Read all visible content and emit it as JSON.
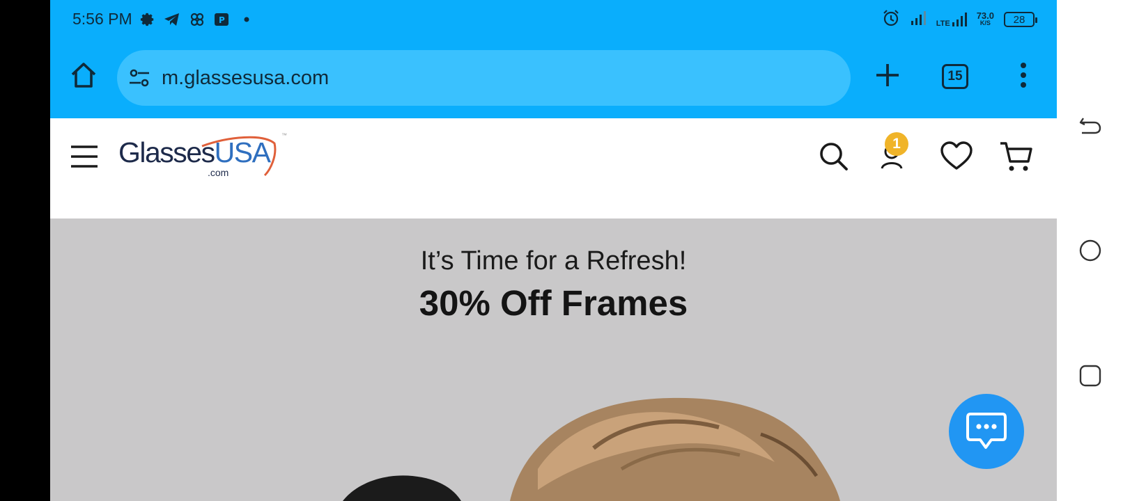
{
  "status_bar": {
    "time": "5:56 PM",
    "network_label": "LTE",
    "speed_value": "73.0",
    "speed_unit": "K/S",
    "battery": "28",
    "notification_icons": [
      "settings-icon",
      "telegram-icon",
      "pinwheel-icon",
      "app-icon",
      "dot-icon"
    ]
  },
  "browser": {
    "url": "m.glassesusa.com",
    "tab_count": "15",
    "icons": [
      "home-icon",
      "site-settings-icon",
      "plus-icon",
      "tabs-icon",
      "more-vert-icon"
    ]
  },
  "site_header": {
    "logo_main": "Glasses",
    "logo_accent": "USA",
    "logo_domain": ".com",
    "logo_tm": "™",
    "account_badge": "1",
    "icons": [
      "menu-icon",
      "search-icon",
      "account-icon",
      "heart-icon",
      "cart-icon"
    ]
  },
  "hero": {
    "subtitle": "It’s Time for a Refresh!",
    "title": "30% Off Frames",
    "chat_icon": "chat-bubble-icon"
  },
  "system_nav": {
    "icons": [
      "back-icon",
      "home-circle-icon",
      "recents-icon"
    ]
  },
  "colors": {
    "browser_blue": "#0aaefc",
    "url_box": "#3ac1fe",
    "hero_bg": "#c9c8c9",
    "badge": "#f0b429",
    "chat_button": "#2196f3",
    "logo_navy": "#1d2a4a",
    "logo_blue": "#2f6fbf",
    "logo_swoosh": "#e0603a"
  }
}
